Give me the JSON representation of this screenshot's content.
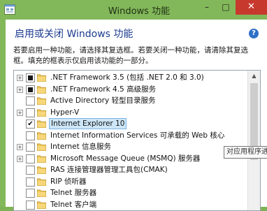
{
  "window": {
    "title": "Windows 功能",
    "minimize_glyph": "–",
    "maximize_glyph": "□",
    "close_glyph": "✕",
    "accent": "#83b85a"
  },
  "header": {
    "heading": "启用或关闭 Windows 功能",
    "help_glyph": "?",
    "description": "若要启用一种功能，请选择其复选框。若要关闭一种功能，请清除其复选框。填充的框表示仅启用该功能的一部分。"
  },
  "features": [
    {
      "label": ".NET Framework 3.5 (包括 .NET 2.0 和 3.0)",
      "expander": "+",
      "state": "partial"
    },
    {
      "label": ".NET Framework 4.5 高级服务",
      "expander": "+",
      "state": "partial"
    },
    {
      "label": "Active Directory 轻型目录服务",
      "expander": "",
      "state": "unchecked"
    },
    {
      "label": "Hyper-V",
      "expander": "+",
      "state": "unchecked"
    },
    {
      "label": "Internet Explorer 10",
      "expander": "",
      "state": "checked"
    },
    {
      "label": "Internet Information Services 可承载的 Web 核心",
      "expander": "",
      "state": "unchecked"
    },
    {
      "label": "Internet 信息服务",
      "expander": "+",
      "state": "unchecked"
    },
    {
      "label": "Microsoft Message Queue (MSMQ) 服务器",
      "expander": "+",
      "state": "unchecked"
    },
    {
      "label": "RAS 连接管理器管理工具包(CMAK)",
      "expander": "",
      "state": "unchecked"
    },
    {
      "label": "RIP 侦听器",
      "expander": "",
      "state": "unchecked"
    },
    {
      "label": "Telnet 服务器",
      "expander": "",
      "state": "unchecked"
    },
    {
      "label": "Telnet 客户端",
      "expander": "",
      "state": "unchecked"
    }
  ],
  "check_glyph": "✔",
  "scroll_up_glyph": "▲",
  "tooltip": "对应用程序进"
}
